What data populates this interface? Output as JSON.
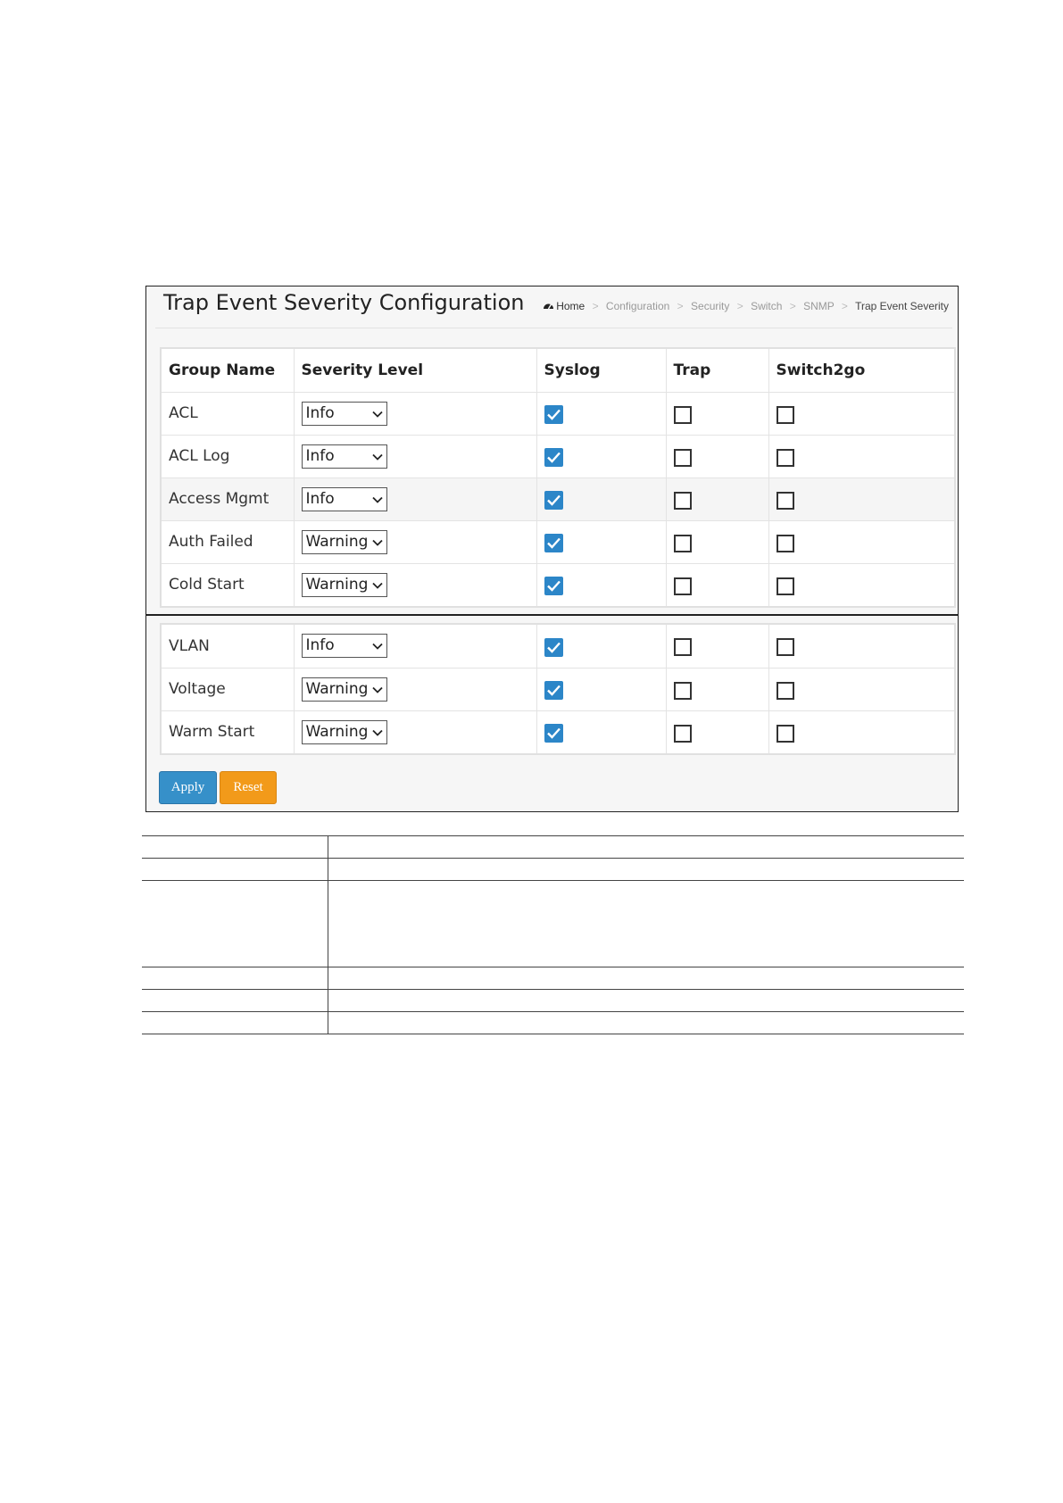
{
  "page": {
    "title": "Trap Event Severity Configuration"
  },
  "breadcrumb": {
    "items": [
      "Home",
      "Configuration",
      "Security",
      "Switch",
      "SNMP",
      "Trap Event Severity"
    ],
    "separator": ">"
  },
  "table": {
    "headers": [
      "Group Name",
      "Severity Level",
      "Syslog",
      "Trap",
      "Switch2go"
    ],
    "rows": [
      {
        "group": "ACL",
        "severity": "Info",
        "syslog": true,
        "trap": false,
        "switch2go": false
      },
      {
        "group": "ACL Log",
        "severity": "Info",
        "syslog": true,
        "trap": false,
        "switch2go": false
      },
      {
        "group": "Access Mgmt",
        "severity": "Info",
        "syslog": true,
        "trap": false,
        "switch2go": false
      },
      {
        "group": "Auth Failed",
        "severity": "Warning",
        "syslog": true,
        "trap": false,
        "switch2go": false
      },
      {
        "group": "Cold Start",
        "severity": "Warning",
        "syslog": true,
        "trap": false,
        "switch2go": false
      },
      {
        "group": "VLAN",
        "severity": "Info",
        "syslog": true,
        "trap": false,
        "switch2go": false
      },
      {
        "group": "Voltage",
        "severity": "Warning",
        "syslog": true,
        "trap": false,
        "switch2go": false
      },
      {
        "group": "Warm Start",
        "severity": "Warning",
        "syslog": true,
        "trap": false,
        "switch2go": false
      }
    ]
  },
  "buttons": {
    "apply_label": "Apply",
    "reset_label": "Reset"
  },
  "colors": {
    "apply": "#3690c9",
    "reset": "#f29a1a",
    "checkbox_checked": "#2c86c8"
  },
  "icons": {
    "home": "dashboard-icon",
    "select": "chevron-down-icon",
    "checked": "checkmark-icon"
  }
}
